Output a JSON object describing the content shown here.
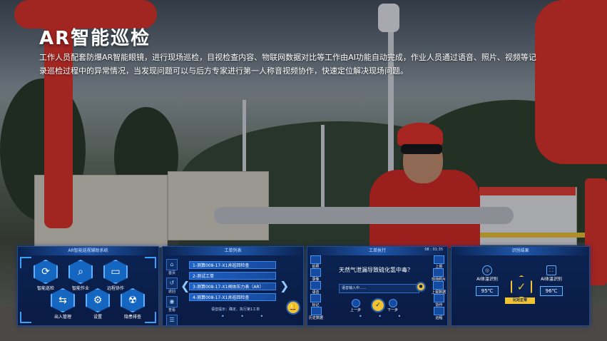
{
  "header": {
    "title": "AR智能巡检",
    "description": "工作人员配套防爆AR智能眼镜，进行现场巡检，目视检查内容、物联网数据对比等工作由AI功能自动完成，作业人员通过语音、照片、视频等记录巡检过程中的异常情况，当发现问题可以与后方专家进行第一人称音视频协作，快速定位解决现场问题。"
  },
  "panel_main_menu": {
    "title": "AR智能巡视辅助系统",
    "items": [
      {
        "label": "智能巡检",
        "icon": "inspection-icon"
      },
      {
        "label": "智能作业",
        "icon": "search-icon"
      },
      {
        "label": "远程协作",
        "icon": "monitor-icon"
      },
      {
        "label": "出入管理",
        "icon": "gate-icon"
      },
      {
        "label": "设置",
        "icon": "gear-icon"
      },
      {
        "label": "隐患排查",
        "icon": "radiation-icon"
      }
    ]
  },
  "panel_work_list": {
    "title": "工单列表",
    "side_icons": [
      {
        "label": "首页",
        "icon": "home-icon"
      },
      {
        "label": "返回",
        "icon": "back-icon"
      },
      {
        "label": "查看",
        "icon": "eye-icon"
      },
      {
        "label": "",
        "icon": "list-icon"
      },
      {
        "label": "上传",
        "icon": "upload-icon"
      }
    ],
    "items": [
      "1-测算008-17-X1井巡回检查",
      "2-测试工单",
      "3-测算008-17-X1阀体压力表（AR）",
      "4-测算008-17-X1井巡回检查"
    ],
    "footer": "语音提示：确定、执行第1工单",
    "dots": "• • •"
  },
  "panel_execute": {
    "title": "工单执行",
    "time": "08 : 01:35",
    "question": "天然气泄漏导致硫化氢中毒？",
    "input_placeholder": "语音输入中......",
    "left_buttons": [
      "拍照",
      "录像",
      "语音",
      "标记",
      "历史数据"
    ],
    "right_buttons": [
      "上报",
      "现场照片",
      "上报数据",
      "协作",
      "远程"
    ],
    "prev_label": "上一步",
    "next_label": "下一步",
    "confirm_label": "确定"
  },
  "panel_result": {
    "title": "识别结果",
    "left_label": "AI体温识别",
    "left_temp": "95℃",
    "right_label": "AI体温识别",
    "right_temp": "96℃",
    "badge": "比对正常"
  }
}
